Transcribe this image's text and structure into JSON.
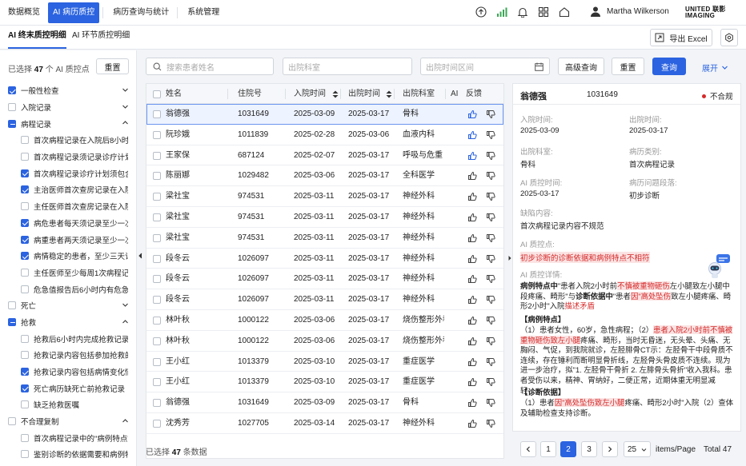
{
  "nav": {
    "items": [
      "数据概览",
      "AI 病历质控",
      "病历查询与统计",
      "系统管理"
    ],
    "active_index": 1,
    "user_name": "Martha Wilkerson",
    "logo_line1": "UNITED 联影",
    "logo_line2": "IMAGING"
  },
  "subnav": {
    "tabs": [
      "AI 终末质控明细",
      "AI 环节质控明细"
    ],
    "export_label": "导出 Excel"
  },
  "sidebar": {
    "selected_prefix": "已选择",
    "selected_count": "47",
    "selected_suffix": "个 AI 质控点",
    "reset_label": "重置",
    "items": [
      {
        "label": "一般性检查",
        "level": 0,
        "check": "checked",
        "chevron": "down"
      },
      {
        "label": "入院记录",
        "level": 0,
        "check": "none",
        "chevron": "down"
      },
      {
        "label": "病程记录",
        "level": 0,
        "check": "partial",
        "chevron": "up"
      },
      {
        "label": "首次病程记录在入院后8小时内完成",
        "level": 1,
        "check": "none"
      },
      {
        "label": "首次病程记录须记录诊疗计划",
        "level": 1,
        "check": "none"
      },
      {
        "label": "首次病程记录诊疗计划须包含具体检查",
        "level": 1,
        "check": "checked"
      },
      {
        "label": "主治医师首次查房记录在入院48小时内",
        "level": 1,
        "check": "checked"
      },
      {
        "label": "主任医师首次查房记录在入院72小时内",
        "level": 1,
        "check": "none"
      },
      {
        "label": "病危患者每天须记录至少一次病程记录",
        "level": 1,
        "check": "checked"
      },
      {
        "label": "病重患者两天须记录至少一次病程记录",
        "level": 1,
        "check": "checked"
      },
      {
        "label": "病情稳定的患者，至少三天记录一次",
        "level": 1,
        "check": "checked"
      },
      {
        "label": "主任医师至少每周1次病程记录",
        "level": 1,
        "check": "none"
      },
      {
        "label": "危急值报告后6小时内有危急值处理记录",
        "level": 1,
        "check": "none"
      },
      {
        "label": "死亡",
        "level": 0,
        "check": "none",
        "chevron": "down"
      },
      {
        "label": "抢救",
        "level": 0,
        "check": "partial",
        "chevron": "up"
      },
      {
        "label": "抢救后6小时内完成抢救记录",
        "level": 1,
        "check": "none"
      },
      {
        "label": "抢救记录内容包括参加抢救的人员",
        "level": 1,
        "check": "none"
      },
      {
        "label": "抢救记录内容包括病情变化情况",
        "level": 1,
        "check": "checked"
      },
      {
        "label": "死亡病历缺死亡前抢救记录",
        "level": 1,
        "check": "checked"
      },
      {
        "label": "缺乏抢救医嘱",
        "level": 1,
        "check": "none"
      },
      {
        "label": "不合理复制",
        "level": 0,
        "check": "none",
        "chevron": "up"
      },
      {
        "label": "首次病程记录中的\"病例特点\"",
        "level": 1,
        "check": "none"
      },
      {
        "label": "鉴别诊断的依据需要和病例特点",
        "level": 1,
        "check": "none"
      }
    ]
  },
  "filters": {
    "search_placeholder": "搜索患者姓名",
    "dept_placeholder": "出院科室",
    "date_placeholder": "出院时间区间",
    "advanced_label": "高级查询",
    "reset_label": "重置",
    "query_label": "查询",
    "expand_label": "展开"
  },
  "table": {
    "columns": [
      "姓名",
      "住院号",
      "入院时间",
      "出院时间",
      "出院科室",
      "AI",
      "反馈"
    ],
    "rows": [
      {
        "name": "翁德强",
        "id": "1031649",
        "admit": "2025-03-09",
        "discharge": "2025-03-17",
        "dept": "骨科"
      },
      {
        "name": "阮珍娥",
        "id": "1011839",
        "admit": "2025-02-28",
        "discharge": "2025-03-06",
        "dept": "血液内科"
      },
      {
        "name": "王家保",
        "id": "687124",
        "admit": "2025-02-07",
        "discharge": "2025-03-17",
        "dept": "呼吸与危重"
      },
      {
        "name": "陈丽娜",
        "id": "1029482",
        "admit": "2025-03-06",
        "discharge": "2025-03-17",
        "dept": "全科医学"
      },
      {
        "name": "梁社宝",
        "id": "974531",
        "admit": "2025-03-11",
        "discharge": "2025-03-17",
        "dept": "神经外科"
      },
      {
        "name": "梁社宝",
        "id": "974531",
        "admit": "2025-03-11",
        "discharge": "2025-03-17",
        "dept": "神经外科"
      },
      {
        "name": "梁社宝",
        "id": "974531",
        "admit": "2025-03-11",
        "discharge": "2025-03-17",
        "dept": "神经外科"
      },
      {
        "name": "段冬云",
        "id": "1026097",
        "admit": "2025-03-11",
        "discharge": "2025-03-17",
        "dept": "神经外科"
      },
      {
        "name": "段冬云",
        "id": "1026097",
        "admit": "2025-03-11",
        "discharge": "2025-03-17",
        "dept": "神经外科"
      },
      {
        "name": "段冬云",
        "id": "1026097",
        "admit": "2025-03-11",
        "discharge": "2025-03-17",
        "dept": "神经外科"
      },
      {
        "name": "林叶秋",
        "id": "1000122",
        "admit": "2025-03-06",
        "discharge": "2025-03-17",
        "dept": "烧伤整形外科"
      },
      {
        "name": "林叶秋",
        "id": "1000122",
        "admit": "2025-03-06",
        "discharge": "2025-03-17",
        "dept": "烧伤整形外科"
      },
      {
        "name": "王小红",
        "id": "1013379",
        "admit": "2025-03-10",
        "discharge": "2025-03-17",
        "dept": "重症医学"
      },
      {
        "name": "王小红",
        "id": "1013379",
        "admit": "2025-03-10",
        "discharge": "2025-03-17",
        "dept": "重症医学"
      },
      {
        "name": "翁德强",
        "id": "1031649",
        "admit": "2025-03-09",
        "discharge": "2025-03-17",
        "dept": "骨科"
      },
      {
        "name": "沈秀芳",
        "id": "1027705",
        "admit": "2025-03-14",
        "discharge": "2025-03-17",
        "dept": "神经外科"
      }
    ],
    "highlighted_row": 0,
    "total_prefix": "已选择",
    "total_count": "47",
    "total_suffix": "条数据"
  },
  "pagination": {
    "pages": [
      "1",
      "2",
      "3"
    ],
    "active_page": "2",
    "page_size": "25",
    "per_page_label": "items/Page",
    "total_label": "Total 47"
  },
  "detail": {
    "name": "翁德强",
    "id": "1031649",
    "status": "不合规",
    "admit_label": "入院时间:",
    "admit_value": "2025-03-09",
    "discharge_label": "出院时间:",
    "discharge_value": "2025-03-17",
    "dept_label": "出院科室:",
    "dept_value": "骨科",
    "category_label": "病历类别:",
    "category_value": "首次病程记录",
    "qc_time_label": "AI 质控时间:",
    "qc_time_value": "2025-03-17",
    "problem_stage_label": "病历问题段落:",
    "problem_stage_value": "初步诊断",
    "defect_label": "缺陷内容:",
    "defect_value": "首次病程记录内容不规范",
    "qc_point_label": "AI 质控点:",
    "qc_point_value": "初步诊断的诊断依据和病例特点不相符",
    "qc_detail_label": "AI 质控详情:",
    "detail_p1_a": "病例特点中",
    "detail_p1_b": "\"患者入院2小时前",
    "detail_p1_c": "不慎被重物砸伤",
    "detail_p1_d": "左小腿致左小腿中段疼痛、畸形\"与",
    "detail_p1_e": "诊断依据中",
    "detail_p1_f": "\"患者",
    "detail_p1_g": "因\"高处坠伤",
    "detail_p1_h": "致左小腿疼痛、畸形2小时\"入院",
    "detail_p1_i": "描述矛盾",
    "case_title": "【病例特点】",
    "case_a": "（1）患者女性，60岁，急性病程；（2）",
    "case_b": "患者入院2小时前不慎被重物砸伤致左小腿",
    "case_c": "疼痛、畸形，当时无昏迷，无头晕、头痛、无胸闷、气促，到我院就诊，左胫腓骨CT示：左胫骨干中段骨质不连续，存在锤利而断明显骨折线，左胫骨头骨皮质不连续。现为进一步治疗，拟\"1. 左胫骨干骨折 2. 左腓骨头骨折\"收入我科。患者受伤以来，精神、胃纳好，二便正常，近期体重无明显减轻……",
    "diag_title": "【诊断依据】",
    "diag_a": "（1）患者",
    "diag_b": "因\"高处坠伤致左小腿",
    "diag_c": "疼痛、畸形2小时\"入院（2）查体及辅助检查支持诊断。"
  },
  "colors": {
    "accent": "#2b63e0",
    "error": "#d52a2a",
    "highlight_bg": "#fbe3e3"
  },
  "icons": [
    "upload-icon",
    "signal-icon",
    "bell-icon",
    "grid-icon",
    "home-icon",
    "user-icon",
    "settings-icon",
    "search-icon",
    "calendar-icon",
    "thumb-up-icon",
    "thumb-down-icon",
    "chevron-down-icon",
    "assistant-robot-icon"
  ]
}
